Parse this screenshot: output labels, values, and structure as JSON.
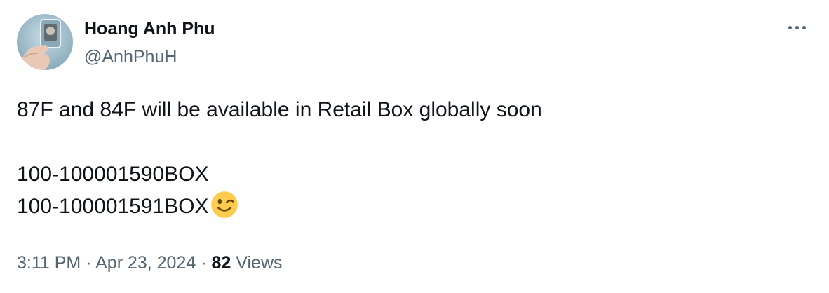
{
  "author": {
    "name": "Hoang Anh Phu",
    "handle": "@AnhPhuH",
    "avatar_icon": "avatar-photo-icon"
  },
  "menu": {
    "icon": "more-options-icon"
  },
  "tweet": {
    "lines": [
      "87F and 84F will be available in Retail Box globally soon",
      "",
      "100-100001590BOX",
      "100-100001591BOX"
    ],
    "emoji": "😉",
    "emoji_icon": "winking-face-emoji"
  },
  "meta": {
    "time": "3:11 PM",
    "separator": "·",
    "date": "Apr 23, 2024",
    "views_count": "82",
    "views_label": "Views"
  },
  "colors": {
    "text_primary": "#0f1419",
    "text_secondary": "#536471",
    "background": "#ffffff",
    "emoji_yellow": "#ffcc4d"
  }
}
